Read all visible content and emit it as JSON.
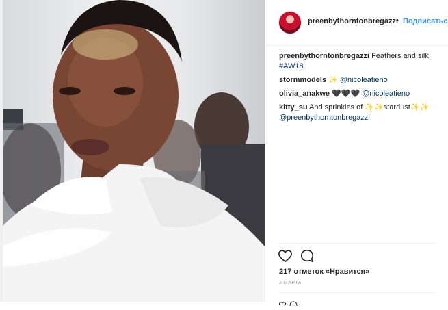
{
  "post": {
    "username": "preenbythorntonbregazzi",
    "separator": "•",
    "follow_label": "Подписаться",
    "caption_username": "preenbythorntonbregazzi",
    "caption_text": " Feathers and silk",
    "caption_hashtag": "#AW18",
    "comments": [
      {
        "user": "stormmodels",
        "text": " ✨ ",
        "mention": "@nicoleatieno"
      },
      {
        "user": "olivia_anakwe",
        "text": " 🖤🖤🖤 ",
        "mention": "@nicoleatieno"
      },
      {
        "user": "kitty_su",
        "text": " And sprinkles of ✨✨stardust✨✨ ",
        "mention": "@preenbythorntonbregazzi"
      }
    ],
    "likes_text": "217 отметок «Нравится»",
    "date": "2 марта"
  },
  "icons": {
    "like": "heart-icon",
    "comment": "comment-bubble-icon",
    "avatar": "profile-avatar"
  },
  "colors": {
    "link": "#003569",
    "follow": "#3897f0",
    "text": "#262626",
    "muted": "#999999"
  }
}
